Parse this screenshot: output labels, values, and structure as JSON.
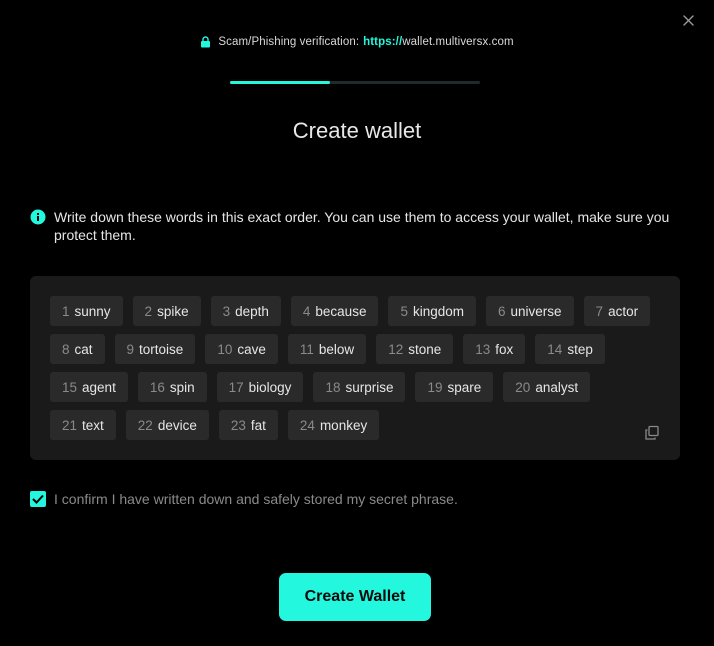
{
  "verification": {
    "label": "Scam/Phishing verification:",
    "protocol": "https://",
    "domain": "wallet.multiversx.com",
    "icon": "lock-icon"
  },
  "progress": {
    "step_fraction": 0.4
  },
  "title": "Create wallet",
  "info": {
    "icon": "info-icon",
    "text": "Write down these words in this exact order. You can use them to access your wallet, make sure you protect them."
  },
  "mnemonic": {
    "words": [
      {
        "num": "1",
        "word": "sunny"
      },
      {
        "num": "2",
        "word": "spike"
      },
      {
        "num": "3",
        "word": "depth"
      },
      {
        "num": "4",
        "word": "because"
      },
      {
        "num": "5",
        "word": "kingdom"
      },
      {
        "num": "6",
        "word": "universe"
      },
      {
        "num": "7",
        "word": "actor"
      },
      {
        "num": "8",
        "word": "cat"
      },
      {
        "num": "9",
        "word": "tortoise"
      },
      {
        "num": "10",
        "word": "cave"
      },
      {
        "num": "11",
        "word": "below"
      },
      {
        "num": "12",
        "word": "stone"
      },
      {
        "num": "13",
        "word": "fox"
      },
      {
        "num": "14",
        "word": "step"
      },
      {
        "num": "15",
        "word": "agent"
      },
      {
        "num": "16",
        "word": "spin"
      },
      {
        "num": "17",
        "word": "biology"
      },
      {
        "num": "18",
        "word": "surprise"
      },
      {
        "num": "19",
        "word": "spare"
      },
      {
        "num": "20",
        "word": "analyst"
      },
      {
        "num": "21",
        "word": "text"
      },
      {
        "num": "22",
        "word": "device"
      },
      {
        "num": "23",
        "word": "fat"
      },
      {
        "num": "24",
        "word": "monkey"
      }
    ],
    "copy_icon": "copy-icon"
  },
  "confirm": {
    "checked": true,
    "text": "I confirm I have written down and safely stored my secret phrase."
  },
  "create_button": "Create Wallet",
  "colors": {
    "accent": "#23f7dd",
    "background": "#000000",
    "panel": "#1a1a1a",
    "chip": "#2a2a2a"
  }
}
